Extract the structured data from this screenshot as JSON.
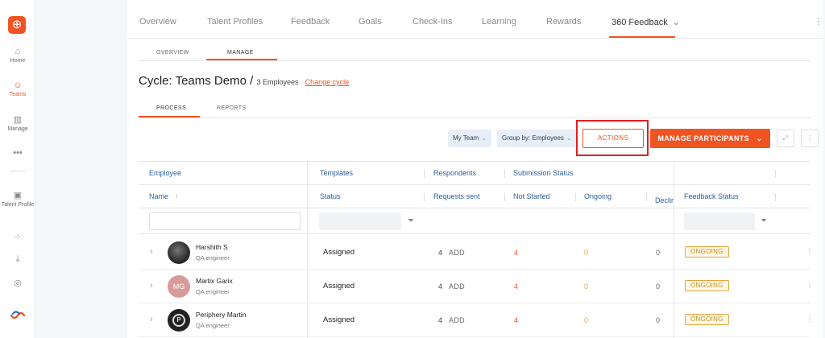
{
  "rail": {
    "items": [
      {
        "label": "Home",
        "icon": "home-icon",
        "glyph": "⌂"
      },
      {
        "label": "Teams",
        "icon": "teams-icon",
        "glyph": "☺"
      },
      {
        "label": "Manage",
        "icon": "manage-icon",
        "glyph": "▥"
      },
      {
        "label": "",
        "icon": "more-icon",
        "glyph": "•••"
      },
      {
        "label": "Talent Profile",
        "icon": "talent-profile-icon",
        "glyph": "▣"
      },
      {
        "label": "",
        "icon": "apps-grid-icon",
        "glyph": "⁘"
      },
      {
        "label": "",
        "icon": "download-icon",
        "glyph": "⤓"
      },
      {
        "label": "",
        "icon": "settings-icon",
        "glyph": "◎"
      }
    ],
    "logo_glyph": "⊕",
    "accent": "#f05423"
  },
  "topnav": {
    "tabs": [
      "Overview",
      "Talent Profiles",
      "Feedback",
      "Goals",
      "Check-Ins",
      "Learning",
      "Rewards",
      "360 Feedback"
    ],
    "active_chevron": "⌄",
    "kebab": "⋮"
  },
  "subtabs": [
    "OVERVIEW",
    "MANAGE"
  ],
  "cycle": {
    "title": "Cycle: Teams Demo /",
    "employees": "3 Employees",
    "change": "Change cycle"
  },
  "process_tabs": [
    "PROCESS",
    "REPORTS"
  ],
  "toolbar": {
    "my_team": "My Team",
    "group_by": "Group by: Employees",
    "actions": "ACTIONS",
    "manage_participants": "MANAGE PARTICIPANTS",
    "chevron": "⌄",
    "expand_glyph": "⤢",
    "kebab": "⋮"
  },
  "table": {
    "group_headers": {
      "employee": "Employee",
      "templates": "Templates",
      "respondents": "Respondents",
      "submission": "Submission Status"
    },
    "col_headers": {
      "name": "Name",
      "sort_glyph": "↑",
      "status": "Status",
      "requests": "Requests sent",
      "not_started": "Not Started",
      "ongoing": "Ongoing",
      "declined": "Declined",
      "feedback_status": "Feedback Status"
    },
    "filter_glyph": "⏷",
    "rows": [
      {
        "name": "Harshith S",
        "role": "QA engineer",
        "avatar": "photo",
        "initials": "",
        "status": "Assigned",
        "requests": "4",
        "add": "ADD",
        "not_started": "4",
        "ongoing": "0",
        "declined": "0",
        "feedback": "ONGOING"
      },
      {
        "name": "Martix Garix",
        "role": "QA engineer",
        "avatar": "initials",
        "initials": "MG",
        "status": "Assigned",
        "requests": "4",
        "add": "ADD",
        "not_started": "4",
        "ongoing": "0",
        "declined": "0",
        "feedback": "ONGOING"
      },
      {
        "name": "Periphery Martin",
        "role": "QA engineer",
        "avatar": "logo",
        "initials": "P",
        "status": "Assigned",
        "requests": "4",
        "add": "ADD",
        "not_started": "4",
        "ongoing": "0",
        "declined": "0",
        "feedback": "ONGOING"
      }
    ]
  }
}
